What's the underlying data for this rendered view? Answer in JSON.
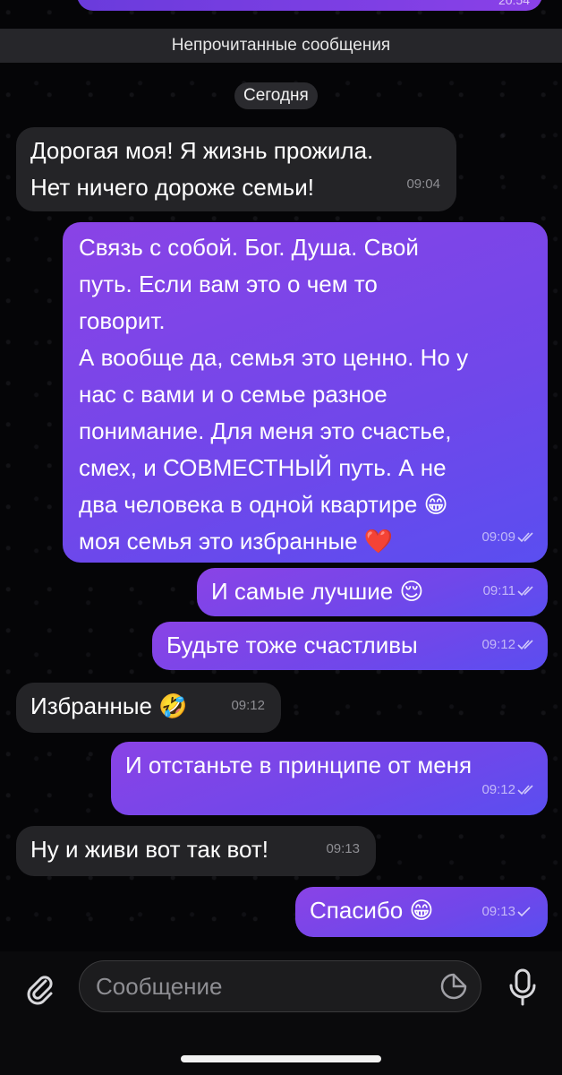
{
  "top": {
    "prev_time": "20:54",
    "unread_label": "Непрочитанные сообщения",
    "date_label": "Сегодня"
  },
  "messages": [
    {
      "dir": "in",
      "text": "Дорогая моя! Я жизнь прожила.\nНет ничего дороже семьи!",
      "time": "09:04"
    },
    {
      "dir": "out",
      "text": "Связь с собой. Бог. Душа. Свой\nпуть. Если вам это о чем то\nговорит.\nА вообще да, семья это ценно. Но у\nнас с вами и о семье разное\nпонимание. Для меня это счастье,\nсмех, и СОВМЕСТНЫЙ путь. А не\nдва человека в одной квартире 😁\nмоя семья это избранные ❤️",
      "time": "09:09",
      "status": "read"
    },
    {
      "dir": "out",
      "text": "И самые лучшие 😌",
      "time": "09:11",
      "status": "read"
    },
    {
      "dir": "out",
      "text": "Будьте тоже счастливы",
      "time": "09:12",
      "status": "read"
    },
    {
      "dir": "in",
      "text": "Избранные 🤣",
      "time": "09:12"
    },
    {
      "dir": "out",
      "text": "И отстаньте в принципе от меня",
      "time": "09:12",
      "status": "read"
    },
    {
      "dir": "in",
      "text": "Ну и живи вот так вот!",
      "time": "09:13"
    },
    {
      "dir": "out",
      "text": "Спасибо 😁",
      "time": "09:13",
      "status": "sent"
    }
  ],
  "composer": {
    "placeholder": "Сообщение",
    "attach_icon": "paperclip-icon",
    "sticker_icon": "sticker-icon",
    "mic_icon": "microphone-icon"
  },
  "colors": {
    "outgoing_start": "#8a43e6",
    "outgoing_end": "#5a4ef0",
    "incoming": "#242427",
    "background": "#050507"
  }
}
